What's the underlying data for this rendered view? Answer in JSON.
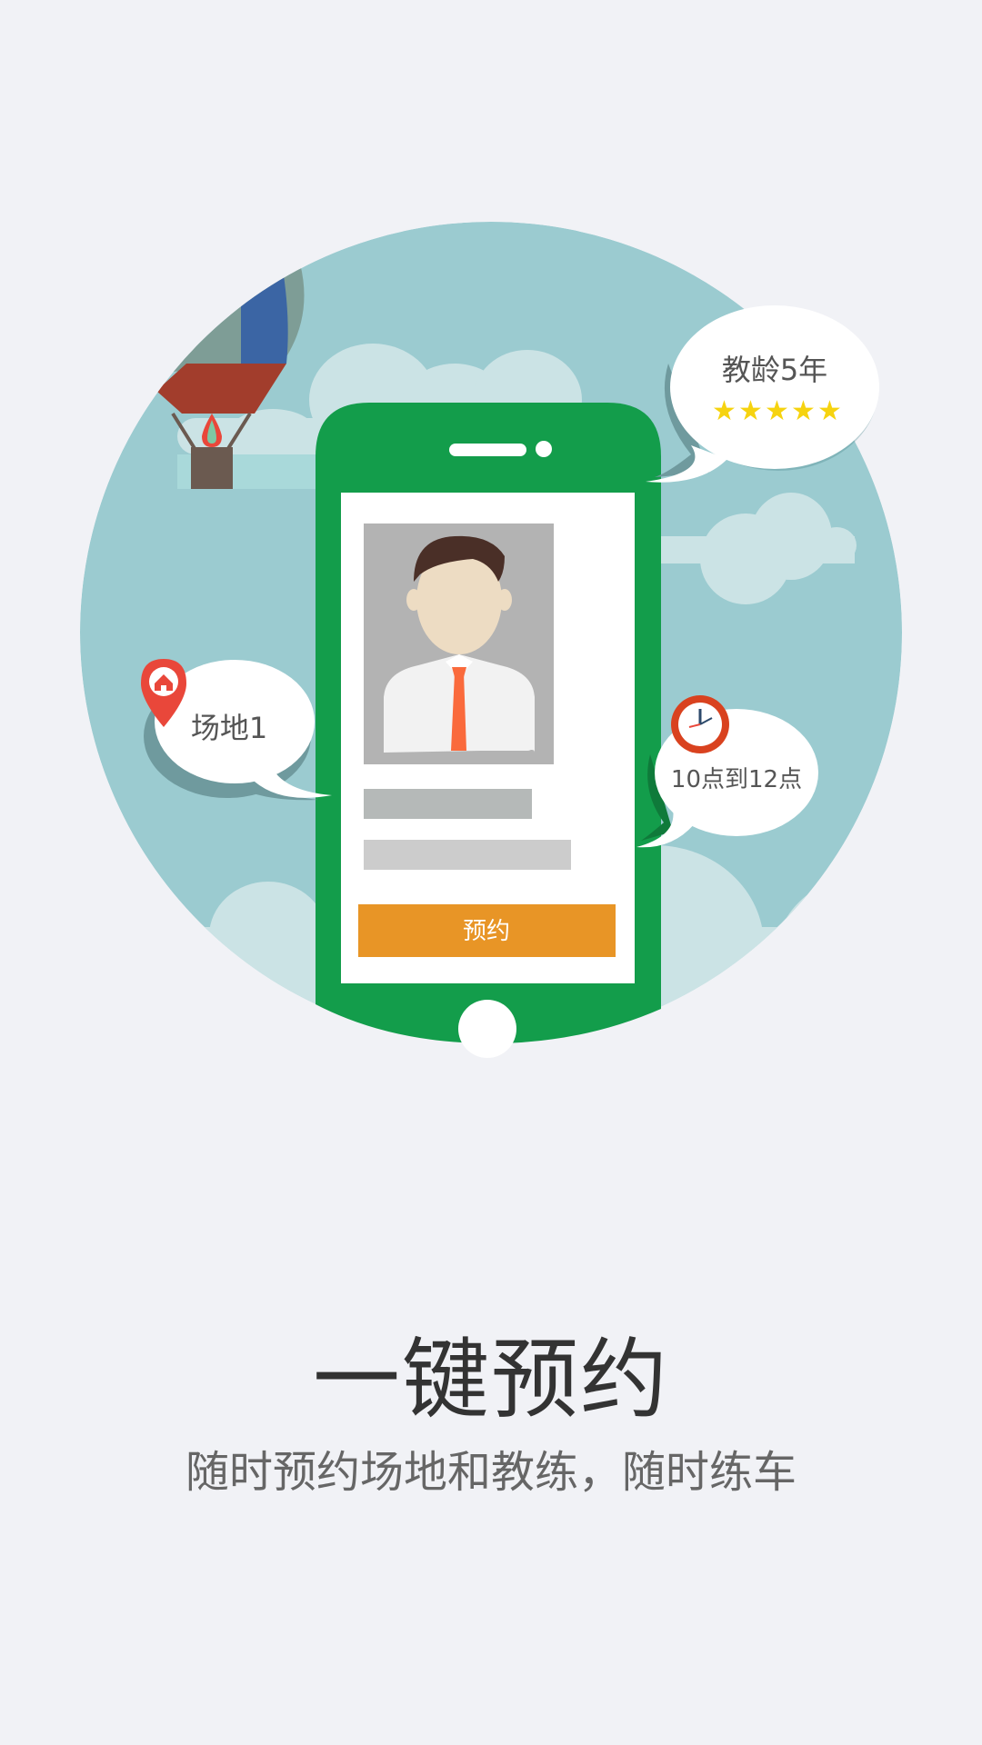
{
  "illustration": {
    "phone": {
      "book_button_label": "预约"
    },
    "bubbles": {
      "teaching_years": "教龄5年",
      "rating_stars": 5,
      "venue": "场地1",
      "time_slot": "10点到12点"
    },
    "icons": {
      "venue_pin": "home-pin-icon",
      "clock": "clock-icon",
      "balloon": "hot-air-balloon",
      "avatar": "coach-avatar"
    },
    "colors": {
      "phone": "#139d4b",
      "book_button": "#e89526",
      "circle": "#9bcbd0",
      "page": "#f1f2f6"
    }
  },
  "heading": "一键预约",
  "subheading": "随时预约场地和教练，随时练车"
}
